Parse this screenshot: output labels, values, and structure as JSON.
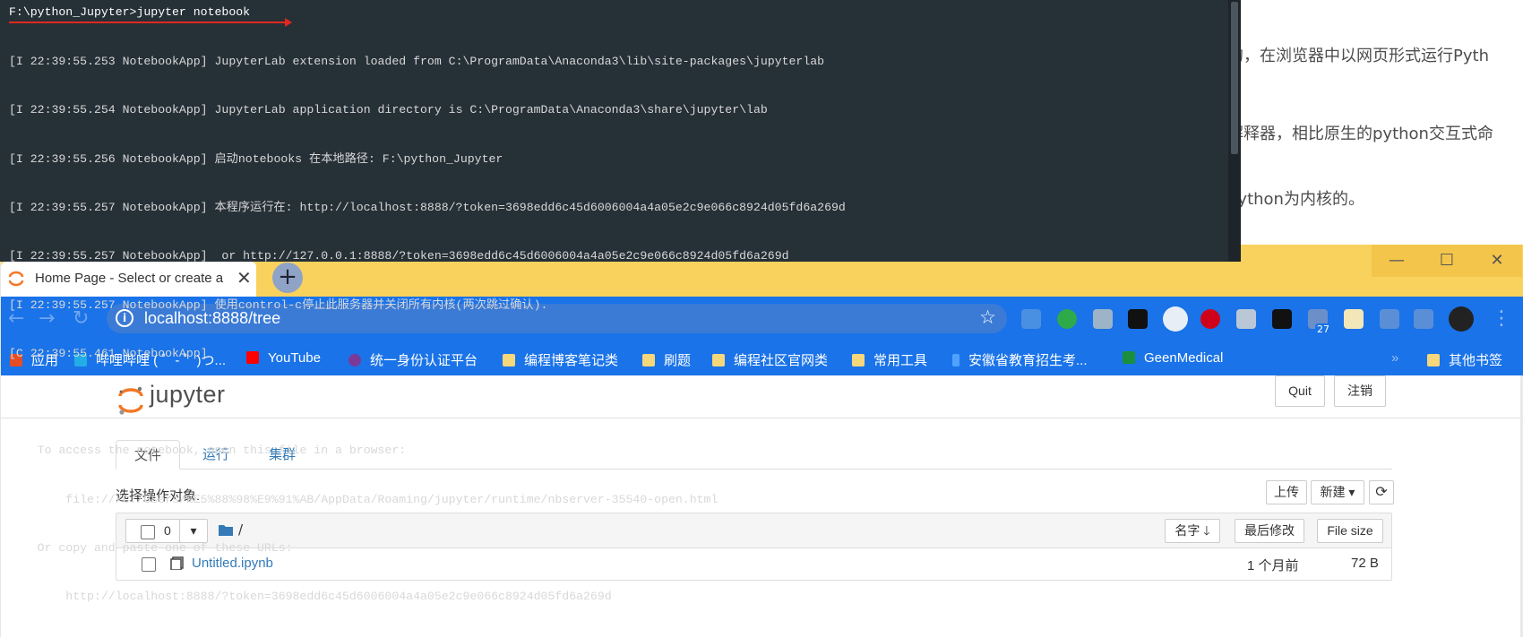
{
  "article": {
    "lines": [
      "的，在浏览器中以网页形式运行Pyth",
      "解释器，相比原生的python交互式命",
      "python为内核的。"
    ]
  },
  "terminal": {
    "prompt": "F:\\python_Jupyter>jupyter notebook",
    "log": [
      "[I 22:39:55.253 NotebookApp] JupyterLab extension loaded from C:\\ProgramData\\Anaconda3\\lib\\site-packages\\jupyterlab",
      "[I 22:39:55.254 NotebookApp] JupyterLab application directory is C:\\ProgramData\\Anaconda3\\share\\jupyter\\lab",
      "[I 22:39:55.256 NotebookApp] 启动notebooks 在本地路径: F:\\python_Jupyter",
      "[I 22:39:55.257 NotebookApp] 本程序运行在: http://localhost:8888/?token=3698edd6c45d6006004a4a05e2c9e066c8924d05fd6a269d",
      "[I 22:39:55.257 NotebookApp]  or http://127.0.0.1:8888/?token=3698edd6c45d6006004a4a05e2c9e066c8924d05fd6a269d",
      "[I 22:39:55.257 NotebookApp] 使用control-c停止此服务器并关闭所有内核(两次跳过确认).",
      "[C 22:39:55.461 NotebookApp]",
      "",
      "    To access the notebook, open this file in a browser:",
      "        file:///C:/Users/%E5%88%98%E9%91%AB/AppData/Roaming/jupyter/runtime/nbserver-35540-open.html",
      "    Or copy and paste one of these URLs:",
      "        http://localhost:8888/?token=3698edd6c45d6006004a4a05e2c9e066c8924d05fd6a269d"
    ]
  },
  "browser": {
    "tab_title": "Home Page - Select or create a notebook",
    "tab_close": "✕",
    "new_tab": "+",
    "window_controls": {
      "minimize": "—",
      "maximize": "☐",
      "close": "✕"
    },
    "url": "localhost:8888/tree",
    "ext_badge": "27",
    "bookmarks": [
      {
        "label": "应用",
        "color": "#e44d26"
      },
      {
        "label": "哔哩哔哩 ( ゜- ゜)つ...",
        "color": "#23ade5"
      },
      {
        "label": "YouTube",
        "color": "#ff0000"
      },
      {
        "label": "统一身份认证平台",
        "color": "#7b3a9a"
      },
      {
        "label": "编程博客笔记类",
        "color": "#f6d77a"
      },
      {
        "label": "刷题",
        "color": "#f6d77a"
      },
      {
        "label": "编程社区官网类",
        "color": "#f6d77a"
      },
      {
        "label": "常用工具",
        "color": "#f6d77a"
      },
      {
        "label": "安徽省教育招生考...",
        "color": "#4fa3ff"
      },
      {
        "label": "GeenMedical",
        "color": "#1b8f3c"
      },
      {
        "label": "其他书签",
        "color": "#f6d77a"
      }
    ],
    "bookmark_more": "»"
  },
  "jupyter": {
    "logo_text": "jupyter",
    "quit": "Quit",
    "logout": "注销",
    "tabs": [
      "文件",
      "运行",
      "集群"
    ],
    "hint": "选择操作对象.",
    "upload": "上传",
    "new": "新建 ▾",
    "refresh": "⟳",
    "selected_count": "0",
    "dropdown_caret": "▾",
    "breadcrumb": "/",
    "sort_name": "名字 🡓",
    "sort_modified": "最后修改",
    "sort_size": "File size",
    "files": [
      {
        "name": "Untitled.ipynb",
        "modified": "1 个月前",
        "size": "72 B"
      }
    ]
  },
  "colors": {
    "terminal_bg": "#263037",
    "tabbar_bg": "#f9d25d",
    "toolbar_bg": "#1a73e8",
    "link": "#337ab7"
  }
}
